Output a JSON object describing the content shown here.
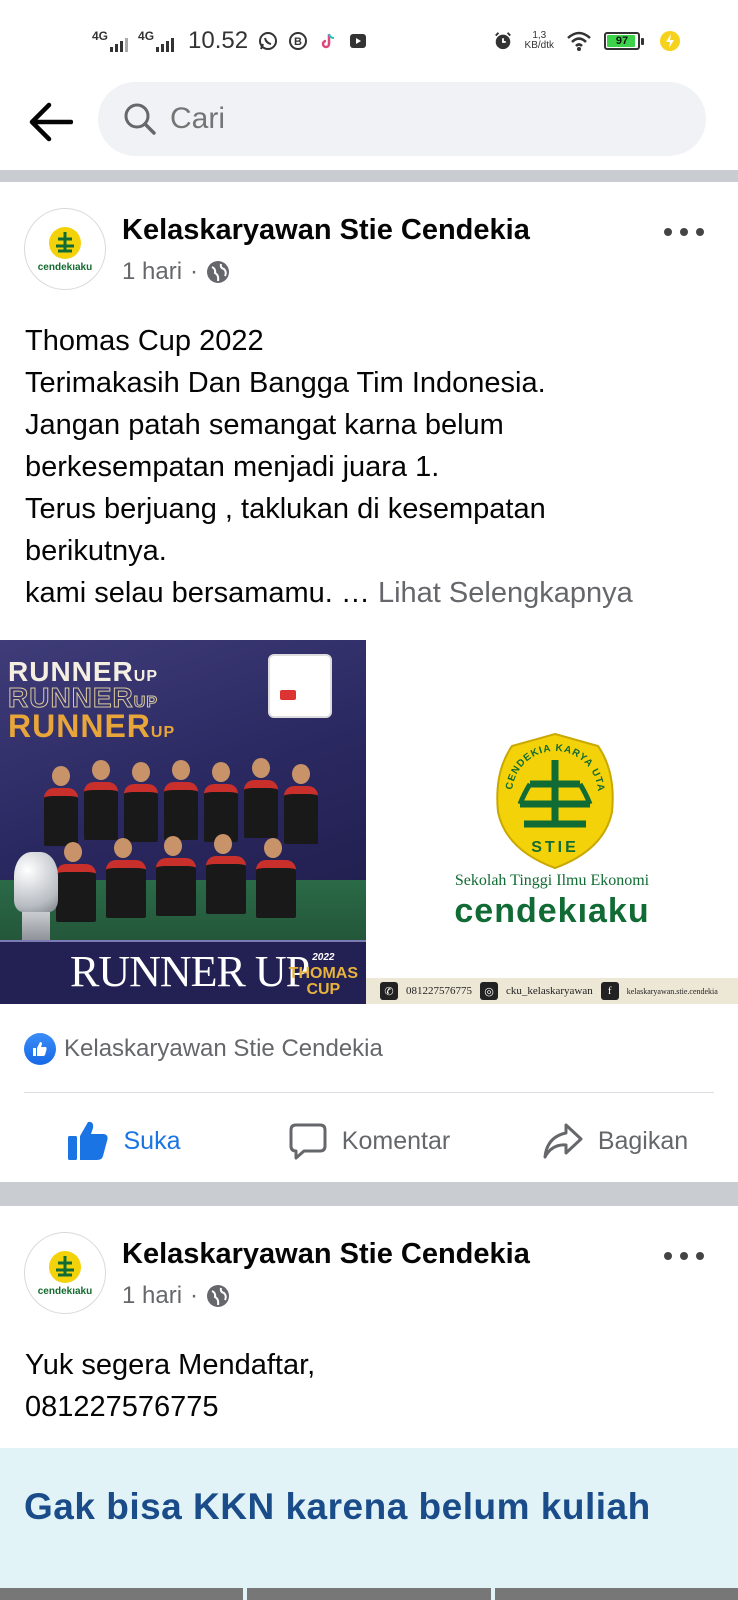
{
  "status_bar": {
    "network_1": "4G",
    "network_2": "4G",
    "time": "10.52",
    "speed_value": "1,3",
    "speed_unit": "KB/dtk",
    "battery": "97",
    "notification_icons": [
      "whatsapp-icon",
      "b-icon",
      "tiktok-icon",
      "play-icon"
    ],
    "status_icons": [
      "alarm-icon",
      "wifi-icon",
      "battery-icon",
      "charging-icon"
    ]
  },
  "search": {
    "placeholder": "Cari"
  },
  "colors": {
    "accent": "#1b74e4",
    "secondary_text": "#65676b",
    "divider": "#c9ccd1",
    "logo_green": "#116b34",
    "logo_yellow": "#f4d20a"
  },
  "posts": [
    {
      "author": "Kelaskaryawan Stie Cendekia",
      "time": "1 hari",
      "separator": "·",
      "avatar_text": "cendekıaku",
      "text_lines": [
        "Thomas Cup 2022",
        "Terimakasih Dan Bangga Tim Indonesia.",
        "Jangan patah semangat karna belum",
        "berkesempatan menjadi juara 1.",
        "Terus berjuang , taklukan di kesempatan",
        "berikutnya.",
        "kami selau bersamamu. … "
      ],
      "see_more": "Lihat Selengkapnya",
      "image_left": {
        "runner_word": "RUNNER",
        "runner_suffix": "UP",
        "banner": "RUNNER UP",
        "year": "2022",
        "thomas": "THOMAS",
        "cup": "CUP"
      },
      "image_right": {
        "arc_text": "CENDEKIA KARYA UTAMA",
        "stie": "STIE",
        "caption": "Sekolah Tinggi Ilmu Ekonomi",
        "wordmark": "cendekıaku",
        "phone": "081227576775",
        "instagram": "cku_kelaskaryawan",
        "facebook": "kelaskaryawan.stie.cendekia"
      },
      "reaction_name": "Kelaskaryawan Stie Cendekia",
      "actions": {
        "like": "Suka",
        "comment": "Komentar",
        "share": "Bagikan"
      }
    },
    {
      "author": "Kelaskaryawan Stie Cendekia",
      "time": "1 hari",
      "separator": "·",
      "avatar_text": "cendekıaku",
      "text_lines": [
        "Yuk segera Mendaftar,",
        "081227576775"
      ],
      "image_text": "Gak bisa KKN karena belum kuliah"
    }
  ]
}
